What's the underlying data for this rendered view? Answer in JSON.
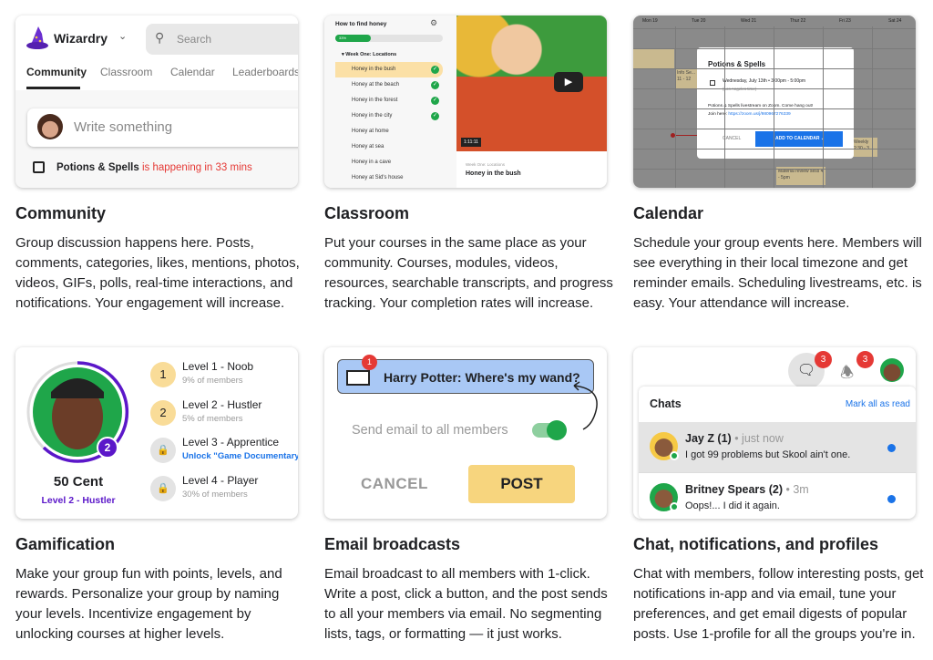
{
  "community": {
    "app_name": "Wizardry",
    "search_placeholder": "Search",
    "tabs": [
      "Community",
      "Classroom",
      "Calendar",
      "Leaderboards"
    ],
    "composer_placeholder": "Write something",
    "event_name": "Potions & Spells",
    "event_status": "is happening in 33 mins",
    "title": "Community",
    "description": "Group discussion happens here. Posts, comments, categories, likes, mentions, photos, videos, GIFs, polls, real-time interactions, and notifications. Your engagement will increase."
  },
  "classroom": {
    "course_title": "How to find honey",
    "progress_label": "33%",
    "progress": 33,
    "module": "Week One: Locations",
    "lessons": [
      {
        "label": "Honey in the bush",
        "done": true
      },
      {
        "label": "Honey at the beach",
        "done": true
      },
      {
        "label": "Honey in the forest",
        "done": true
      },
      {
        "label": "Honey in the city",
        "done": true
      },
      {
        "label": "Honey at home",
        "done": false
      },
      {
        "label": "Honey at sea",
        "done": false
      },
      {
        "label": "Honey in a cave",
        "done": false
      },
      {
        "label": "Honey at Sid's house",
        "done": false
      }
    ],
    "video_time": "1:11:11",
    "video_module": "Week One: Locations",
    "video_title": "Honey in the bush",
    "title": "Classroom",
    "description": "Put your courses in the same place as your community. Courses, modules, videos, resources, searchable transcripts, and progress tracking. Your completion rates will increase."
  },
  "calendar": {
    "days": [
      "Mon 19",
      "Tue 20",
      "Wed 21",
      "Thur 22",
      "Fri 23",
      "Sat 24"
    ],
    "events": [
      "Info Se... 11 - 12",
      "Weekly 2:30 - 3",
      "Material review sess 4 - 5pm"
    ],
    "modal": {
      "title": "Potions & Spells",
      "datetime": "Wednesday, July 13th • 3:00pm - 5:00pm",
      "timezone": "(Los Angeles time)",
      "body": "Potions & Spells livestream on Zoom. Come hang out!",
      "join_label": "Join here:",
      "link": "https://zoom.us/j/980967276339",
      "cancel": "CANCEL",
      "add": "ADD TO CALENDAR"
    },
    "title": "Calendar",
    "description": "Schedule your group events here. Members will see everything in their local timezone and get reminder emails. Scheduling livestreams, etc. is easy. Your attendance will increase."
  },
  "gamification": {
    "name": "50 Cent",
    "level_label": "Level 2 - Hustler",
    "level_badge": "2",
    "levels": [
      {
        "badge": "1",
        "name": "Level 1 - Noob",
        "sub": "9% of members",
        "locked": false
      },
      {
        "badge": "2",
        "name": "Level 2 - Hustler",
        "sub": "5% of members",
        "locked": false
      },
      {
        "badge": "",
        "name": "Level 3 - Apprentice",
        "sub": "Unlock \"Game Documentary\"",
        "locked": true
      },
      {
        "badge": "",
        "name": "Level 4 - Player",
        "sub": "30% of members",
        "locked": true
      }
    ],
    "title": "Gamification",
    "description": "Make your group fun with points, levels, and rewards. Personalize your group by naming your levels. Incentivize engagement by unlocking courses at higher levels."
  },
  "email": {
    "badge": "1",
    "post_title": "Harry Potter: Where's my wand?",
    "toggle_label": "Send email to all members",
    "toggle_on": true,
    "cancel": "CANCEL",
    "post": "POST",
    "title": "Email broadcasts",
    "description": "Email broadcast to all members with 1-click. Write a post, click a button, and the post sends to all your members via email. No segmenting lists, tags, or formatting — it just works."
  },
  "chat": {
    "chat_badge": "3",
    "notif_badge": "3",
    "header": "Chats",
    "mark_read": "Mark all as read",
    "items": [
      {
        "name": "Jay Z (1)",
        "time": "• just now",
        "message": "I got 99 problems but Skool ain't one."
      },
      {
        "name": "Britney Spears (2)",
        "time": "• 3m",
        "message": "Oops!... I did it again."
      }
    ],
    "title": "Chat, notifications, and profiles",
    "description": "Chat with members, follow interesting posts, get notifications in-app and via email, tune your preferences, and get email digests of popular posts. Use 1-profile for all the groups you're in."
  },
  "colors": {
    "accent_blue": "#1a73e8",
    "progress_green": "#1fa64a",
    "level_purple": "#5b17c9",
    "badge_red": "#e53935",
    "post_yellow": "#f7d57e",
    "event_red": "#e53935"
  }
}
